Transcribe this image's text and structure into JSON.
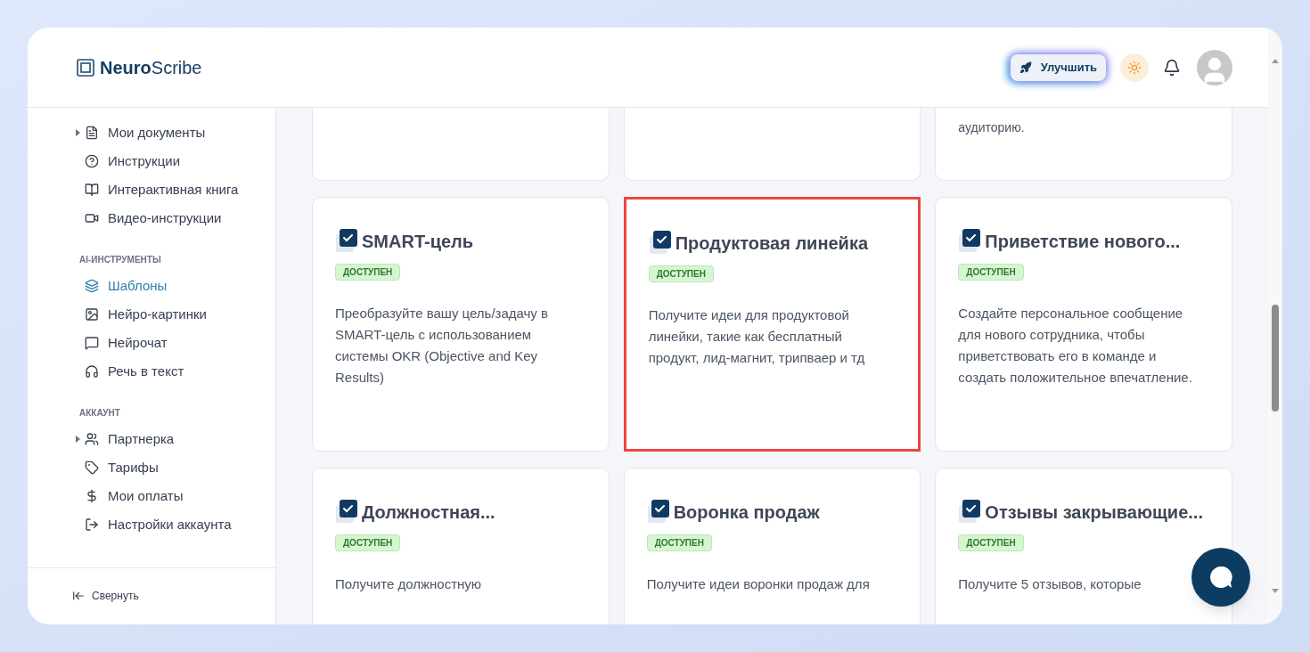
{
  "logo": {
    "bold": "Neuro",
    "regular": "Scribe"
  },
  "header": {
    "upgrade_button": "Улучшить"
  },
  "sidebar": {
    "sections": [
      {
        "items": [
          {
            "label": "Мои документы",
            "expandable": true,
            "selected": false
          },
          {
            "label": "Инструкции",
            "expandable": false,
            "selected": false
          },
          {
            "label": "Интерактивная книга",
            "expandable": false,
            "selected": false
          },
          {
            "label": "Видео-инструкции",
            "expandable": false,
            "selected": false
          }
        ]
      },
      {
        "label": "AI-ИНСТРУМЕНТЫ",
        "items": [
          {
            "label": "Шаблоны",
            "expandable": false,
            "selected": true
          },
          {
            "label": "Нейро-картинки",
            "expandable": false,
            "selected": false
          },
          {
            "label": "Нейрочат",
            "expandable": false,
            "selected": false
          },
          {
            "label": "Речь в текст",
            "expandable": false,
            "selected": false
          }
        ]
      },
      {
        "label": "АККАУНТ",
        "items": [
          {
            "label": "Партнерка",
            "expandable": true,
            "selected": false
          },
          {
            "label": "Тарифы",
            "expandable": false,
            "selected": false
          },
          {
            "label": "Мои оплаты",
            "expandable": false,
            "selected": false
          },
          {
            "label": "Настройки аккаунта",
            "expandable": false,
            "selected": false
          }
        ]
      }
    ],
    "collapse": "Свернуть"
  },
  "top_cards": [
    {
      "kind": "blank"
    },
    {
      "kind": "blank"
    },
    {
      "kind": "text",
      "tail": "аудиторию."
    }
  ],
  "cards": [
    {
      "title": "SMART-цель",
      "badge": "ДОСТУПЕН",
      "description": "Преобразуйте вашу цель/задачу в SMART-цель с использованием системы OKR (Objective and Key Results)",
      "highlighted": false
    },
    {
      "title": "Продуктовая линейка",
      "badge": "ДОСТУПЕН",
      "description": "Получите идеи для продуктовой линейки, такие как бесплатный продукт, лид-магнит, трипваер и тд",
      "highlighted": true
    },
    {
      "title": "Приветствие нового...",
      "badge": "ДОСТУПЕН",
      "description": "Создайте персональное сообщение для нового сотрудника, чтобы приветствовать его в команде и создать положительное впечатление.",
      "highlighted": false
    },
    {
      "title": "Должностная...",
      "badge": "ДОСТУПЕН",
      "description": "Получите должностную",
      "highlighted": false
    },
    {
      "title": "Воронка продаж",
      "badge": "ДОСТУПЕН",
      "description": "Получите идеи воронки продаж для",
      "highlighted": false
    },
    {
      "title": "Отзывы закрывающие...",
      "badge": "ДОСТУПЕН",
      "description": "Получите 5 отзывов, которые",
      "highlighted": false
    }
  ]
}
